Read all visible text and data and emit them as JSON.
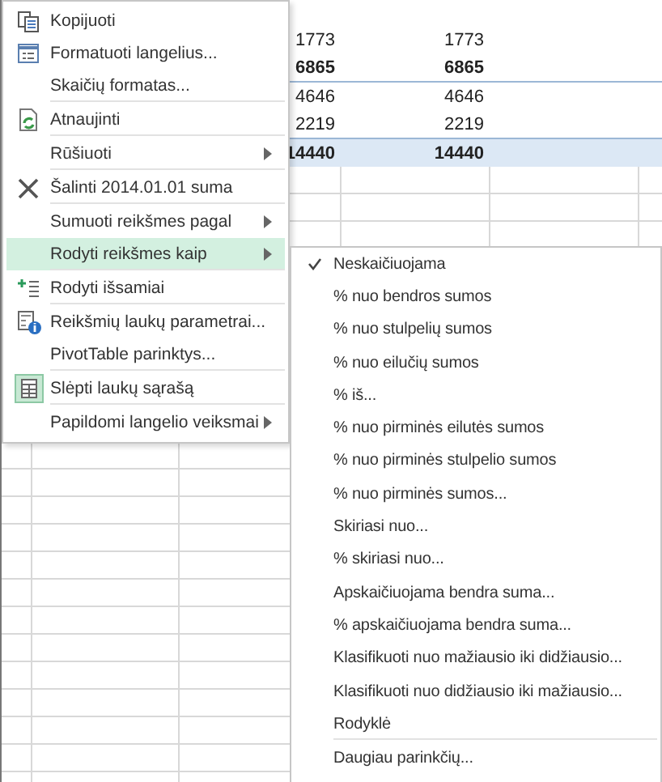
{
  "sheet": {
    "rows": [
      {
        "kind": "item",
        "cells": [
          "1773",
          "1773"
        ]
      },
      {
        "kind": "subtotal",
        "cells": [
          "6865",
          "6865"
        ]
      },
      {
        "kind": "item",
        "cells": [
          "4646",
          "4646"
        ]
      },
      {
        "kind": "item",
        "cells": [
          "2219",
          "2219"
        ]
      },
      {
        "kind": "total",
        "cells": [
          "14440",
          "14440"
        ]
      }
    ]
  },
  "context_menu": {
    "items": [
      {
        "label": "Kopijuoti",
        "kind": "copy",
        "submenu": false,
        "selected": false,
        "separator_after": false
      },
      {
        "label": "Formatuoti langelius...",
        "kind": "format",
        "submenu": false,
        "selected": false,
        "separator_after": false
      },
      {
        "label": "Skaičių formatas...",
        "kind": "none",
        "submenu": false,
        "selected": false,
        "separator_after": true
      },
      {
        "label": "Atnaujinti",
        "kind": "refresh",
        "submenu": false,
        "selected": false,
        "separator_after": true
      },
      {
        "label": "Rūšiuoti",
        "kind": "none",
        "submenu": true,
        "selected": false,
        "separator_after": true
      },
      {
        "label": "Šalinti 2014.01.01 suma",
        "kind": "remove",
        "submenu": false,
        "selected": false,
        "separator_after": true
      },
      {
        "label": "Sumuoti reikšmes pagal",
        "kind": "none",
        "submenu": true,
        "selected": false,
        "separator_after": false
      },
      {
        "label": "Rodyti reikšmes kaip",
        "kind": "none",
        "submenu": true,
        "selected": true,
        "separator_after": true
      },
      {
        "label": "Rodyti išsamiai",
        "kind": "details",
        "submenu": false,
        "selected": false,
        "separator_after": true
      },
      {
        "label": "Reikšmių laukų parametrai...",
        "kind": "settings",
        "submenu": false,
        "selected": false,
        "separator_after": false
      },
      {
        "label": "PivotTable parinktys...",
        "kind": "none",
        "submenu": false,
        "selected": false,
        "separator_after": true
      },
      {
        "label": "Slėpti laukų sąrašą",
        "kind": "fieldlist",
        "submenu": false,
        "selected": false,
        "separator_after": true
      },
      {
        "label": "Papildomi langelio veiksmai",
        "kind": "none",
        "submenu": true,
        "selected": false,
        "separator_after": false
      }
    ]
  },
  "submenu": {
    "items": [
      {
        "label": "Neskaičiuojama",
        "checked": true,
        "separator_after": false
      },
      {
        "label": "% nuo bendros sumos",
        "checked": false,
        "separator_after": false
      },
      {
        "label": "% nuo stulpelių sumos",
        "checked": false,
        "separator_after": false
      },
      {
        "label": "% nuo eilučių sumos",
        "checked": false,
        "separator_after": false
      },
      {
        "label": "% iš...",
        "checked": false,
        "separator_after": false
      },
      {
        "label": "% nuo pirminės eilutės sumos",
        "checked": false,
        "separator_after": false
      },
      {
        "label": "% nuo pirminės stulpelio sumos",
        "checked": false,
        "separator_after": false
      },
      {
        "label": "% nuo pirminės sumos...",
        "checked": false,
        "separator_after": false
      },
      {
        "label": "Skiriasi nuo...",
        "checked": false,
        "separator_after": false
      },
      {
        "label": "% skiriasi nuo...",
        "checked": false,
        "separator_after": false
      },
      {
        "label": "Apskaičiuojama bendra suma...",
        "checked": false,
        "separator_after": false
      },
      {
        "label": "% apskaičiuojama bendra suma...",
        "checked": false,
        "separator_after": false
      },
      {
        "label": "Klasifikuoti nuo mažiausio iki didžiausio...",
        "checked": false,
        "separator_after": false
      },
      {
        "label": "Klasifikuoti nuo didžiausio iki mažiausio...",
        "checked": false,
        "separator_after": false
      },
      {
        "label": "Rodyklė",
        "checked": false,
        "separator_after": true
      },
      {
        "label": "Daugiau parinkčių...",
        "checked": false,
        "separator_after": false
      }
    ]
  }
}
